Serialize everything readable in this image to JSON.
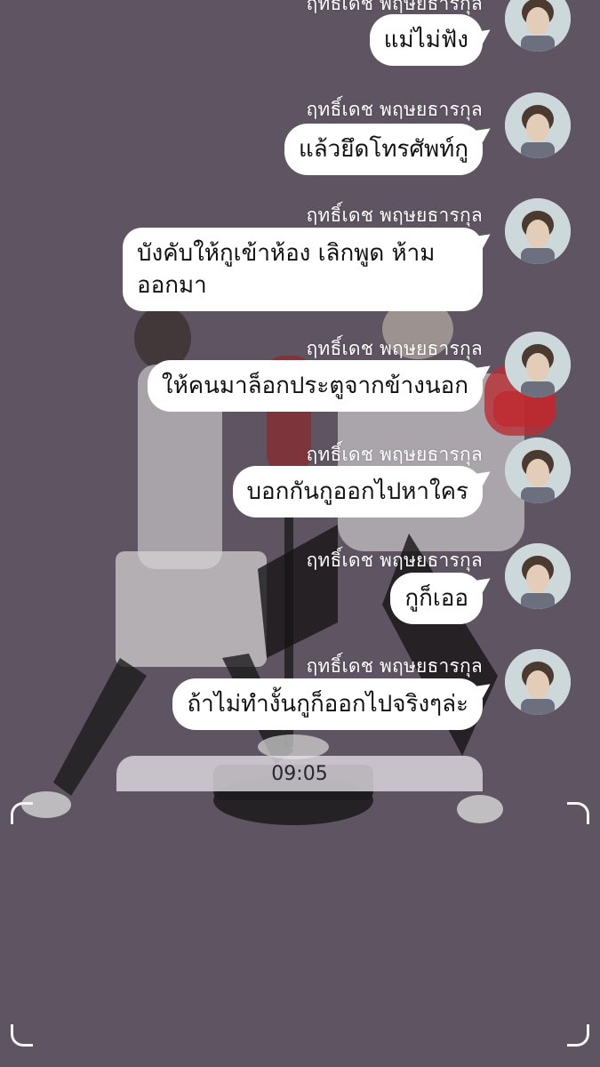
{
  "sender_name": "ฤทธิ์เดช พฤษยธารกุล",
  "messages": [
    {
      "text": "แม่ไม่ฟัง"
    },
    {
      "text": "แล้วยึดโทรศัพท์กู"
    },
    {
      "text": "บังคับให้กูเข้าห้อง เลิกพูด ห้ามออกมา"
    },
    {
      "text": "ให้คนมาล็อกประตูจากข้างนอก"
    },
    {
      "text": "บอกกันกูออกไปหาใคร"
    },
    {
      "text": "กูก็เออ"
    },
    {
      "text": "ถ้าไม่ทำงั้นกูก็ออกไปจริงๆล่ะ"
    }
  ],
  "timestamp": "09:05",
  "colors": {
    "background": "#5e5462",
    "bubble": "#ffffff",
    "sender_text": "#ffffff"
  },
  "icons": {
    "avatar": "profile-photo",
    "corner": "viewfinder-corner"
  }
}
